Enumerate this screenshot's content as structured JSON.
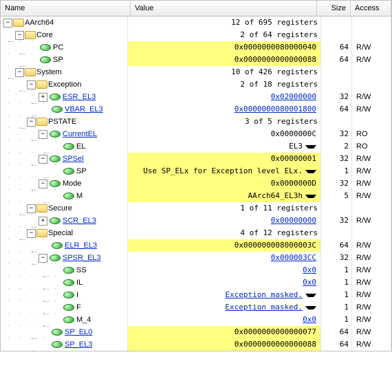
{
  "columns": {
    "name": "Name",
    "value": "Value",
    "size": "Size",
    "access": "Access"
  },
  "tw": {
    "plus": "+",
    "minus": "−"
  },
  "rows": [
    {
      "id": "aarch64",
      "indent": 0,
      "tw": "minus",
      "icon": "folder",
      "label": "AArch64",
      "value": "12 of 695 registers",
      "vclass": "",
      "size": "",
      "access": ""
    },
    {
      "id": "core",
      "indent": 1,
      "tw": "minus",
      "icon": "folder",
      "label": "Core",
      "value": "2 of 64 registers",
      "vclass": "",
      "size": "",
      "access": ""
    },
    {
      "id": "pc",
      "indent": 2,
      "icon": "dot",
      "label": "PC",
      "value": "0x0000000080000040",
      "vclass": "vr hl",
      "size": "64",
      "access": "R/W"
    },
    {
      "id": "sp",
      "indent": 2,
      "icon": "dot",
      "label": "SP",
      "value": "0x0000000000000088",
      "vclass": "vr hl",
      "size": "64",
      "access": "R/W"
    },
    {
      "id": "system",
      "indent": 1,
      "tw": "minus",
      "icon": "folder",
      "label": "System",
      "value": "10 of 426 registers",
      "vclass": "",
      "size": "",
      "access": ""
    },
    {
      "id": "exception",
      "indent": 2,
      "tw": "minus",
      "icon": "folder",
      "label": "Exception",
      "value": "2 of 18 registers",
      "vclass": "",
      "size": "",
      "access": ""
    },
    {
      "id": "esr-el3",
      "indent": 3,
      "tw": "plus",
      "icon": "dot",
      "label": "ESR_EL3",
      "link": true,
      "value": "0x02000000",
      "vclass": "vr",
      "vlink": true,
      "size": "32",
      "access": "R/W"
    },
    {
      "id": "vbar-el3",
      "indent": 3,
      "icon": "dot",
      "label": "VBAR_EL3",
      "link": true,
      "value": "0x0000000080001800",
      "vclass": "vr",
      "vlink": true,
      "size": "64",
      "access": "R/W"
    },
    {
      "id": "pstate",
      "indent": 2,
      "tw": "minus",
      "icon": "folder",
      "label": "PSTATE",
      "value": "3 of 5 registers",
      "vclass": "",
      "size": "",
      "access": ""
    },
    {
      "id": "currentel",
      "indent": 3,
      "tw": "minus",
      "icon": "dot",
      "label": "CurrentEL",
      "link": true,
      "value": "0x0000000C",
      "vclass": "vr",
      "size": "32",
      "access": "RO"
    },
    {
      "id": "el",
      "indent": 4,
      "icon": "dot",
      "label": "EL",
      "value": "EL3",
      "vclass": "vr",
      "dd": true,
      "size": "2",
      "access": "RO"
    },
    {
      "id": "spsel",
      "indent": 3,
      "tw": "minus",
      "icon": "dot",
      "label": "SPSel",
      "link": true,
      "value": "0x00000001",
      "vclass": "vr hl",
      "size": "32",
      "access": "R/W"
    },
    {
      "id": "sp2",
      "indent": 4,
      "icon": "dot",
      "label": "SP",
      "value": "Use SP_ELx for Exception level ELx.",
      "vclass": "vr hl",
      "dd": true,
      "size": "1",
      "access": "R/W"
    },
    {
      "id": "mode",
      "indent": 3,
      "tw": "minus",
      "icon": "dot",
      "label": "Mode",
      "value": "0x0000000D",
      "vclass": "vr hl",
      "size": "32",
      "access": "R/W"
    },
    {
      "id": "m",
      "indent": 4,
      "icon": "dot",
      "label": "M",
      "value": "AArch64_EL3h",
      "vclass": "vr hl",
      "dd": true,
      "size": "5",
      "access": "R/W"
    },
    {
      "id": "secure",
      "indent": 2,
      "tw": "minus",
      "icon": "folder",
      "label": "Secure",
      "value": "1 of 11 registers",
      "vclass": "",
      "size": "",
      "access": ""
    },
    {
      "id": "scr-el3",
      "indent": 3,
      "tw": "plus",
      "icon": "dot",
      "label": "SCR_EL3",
      "link": true,
      "value": "0x00000000",
      "vclass": "vr",
      "vlink": true,
      "size": "32",
      "access": "R/W"
    },
    {
      "id": "special",
      "indent": 2,
      "tw": "minus",
      "icon": "folder",
      "label": "Special",
      "value": "4 of 12 registers",
      "vclass": "",
      "size": "",
      "access": ""
    },
    {
      "id": "elr-el3",
      "indent": 3,
      "icon": "dot",
      "label": "ELR_EL3",
      "link": true,
      "value": "0x000000008000003C",
      "vclass": "vr hl",
      "size": "64",
      "access": "R/W"
    },
    {
      "id": "spsr-el3",
      "indent": 3,
      "tw": "minus",
      "icon": "dot",
      "label": "SPSR_EL3",
      "link": true,
      "value": "0x000003CC",
      "vclass": "vr",
      "vlink": true,
      "size": "32",
      "access": "R/W"
    },
    {
      "id": "ss",
      "indent": 4,
      "icon": "dot",
      "label": "SS",
      "value": "0x0",
      "vclass": "vr",
      "vlink": true,
      "size": "1",
      "access": "R/W"
    },
    {
      "id": "il",
      "indent": 4,
      "icon": "dot",
      "label": "IL",
      "value": "0x0",
      "vclass": "vr",
      "vlink": true,
      "size": "1",
      "access": "R/W"
    },
    {
      "id": "i",
      "indent": 4,
      "icon": "dot",
      "label": "I",
      "value": "Exception masked.",
      "vclass": "vr",
      "vlink": true,
      "dd": true,
      "size": "1",
      "access": "R/W"
    },
    {
      "id": "f",
      "indent": 4,
      "icon": "dot",
      "label": "F",
      "value": "Exception masked.",
      "vclass": "vr",
      "vlink": true,
      "dd": true,
      "size": "1",
      "access": "R/W"
    },
    {
      "id": "m4",
      "indent": 4,
      "icon": "dot",
      "label": "M_4",
      "value": "0x0",
      "vclass": "vr",
      "vlink": true,
      "size": "1",
      "access": "R/W"
    },
    {
      "id": "sp-el0",
      "indent": 3,
      "icon": "dot",
      "label": "SP_EL0",
      "link": true,
      "value": "0x0000000000000077",
      "vclass": "vr hl",
      "size": "64",
      "access": "R/W"
    },
    {
      "id": "sp-el3",
      "indent": 3,
      "icon": "dot",
      "label": "SP_EL3",
      "link": true,
      "value": "0x0000000000000088",
      "vclass": "vr hl",
      "size": "64",
      "access": "R/W"
    }
  ]
}
